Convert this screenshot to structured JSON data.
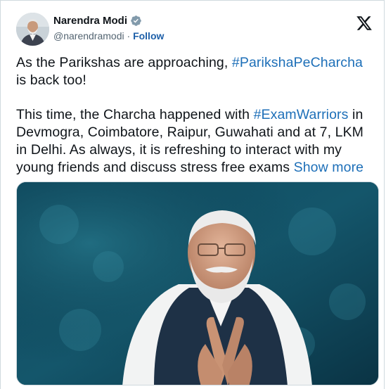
{
  "author": {
    "name": "Narendra Modi",
    "handle": "@narendramodi",
    "separator": "·",
    "follow_label": "Follow"
  },
  "icons": {
    "verified": "verified-badge-icon",
    "brand": "x-logo-icon"
  },
  "colors": {
    "link": "#1d6fb8",
    "text": "#0f1419",
    "muted": "#536471",
    "verified": "#829aab"
  },
  "post": {
    "p1_before": "As the Parikshas are approaching, ",
    "p1_hashtag": "#ParikshaPeCharcha",
    "p1_after": " is back too!",
    "p2_before": "This time, the Charcha happened with ",
    "p2_hashtag": "#ExamWarriors",
    "p2_after": " in Devmogra, Coimbatore, Raipur, Guwahati and at 7, LKM in Delhi. As always, it is refreshing to interact with my young friends and discuss stress free exams ",
    "show_more": "Show more"
  }
}
